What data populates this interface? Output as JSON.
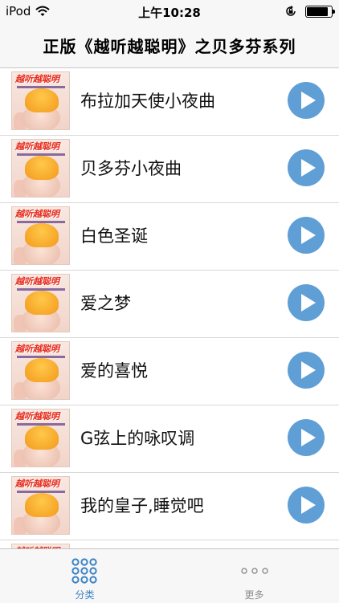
{
  "status_bar": {
    "device": "iPod",
    "time": "上午10:28",
    "battery_level": 0.9
  },
  "nav": {
    "title": "正版《越听越聪明》之贝多芬系列"
  },
  "thumbnail": {
    "logo_text": "越听越聪明"
  },
  "tracks": [
    {
      "title": "布拉加天使小夜曲"
    },
    {
      "title": "贝多芬小夜曲"
    },
    {
      "title": "白色圣诞"
    },
    {
      "title": "爱之梦"
    },
    {
      "title": "爱的喜悦"
    },
    {
      "title": "G弦上的咏叹调"
    },
    {
      "title": "我的皇子,睡觉吧"
    },
    {
      "title": ""
    }
  ],
  "tabs": [
    {
      "label": "分类",
      "icon": "grid-icon",
      "active": true
    },
    {
      "label": "更多",
      "icon": "more-dots-icon",
      "active": false
    }
  ],
  "colors": {
    "accent": "#5f9fd6",
    "tab_active": "#3b82c4",
    "tab_inactive": "#8e8e8e"
  }
}
